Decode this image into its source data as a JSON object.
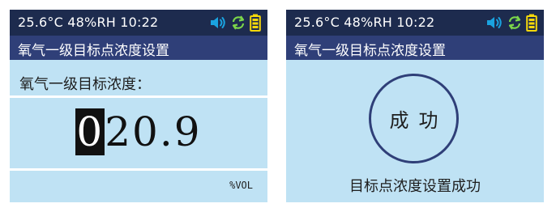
{
  "status": {
    "text": "25.6°C 48%RH 10:22",
    "icons": [
      "speaker-icon",
      "sync-icon",
      "battery-icon"
    ],
    "colors": {
      "speaker": "#1aa3e0",
      "sync": "#7bd64a",
      "battery": "#f5d80a"
    }
  },
  "left_screen": {
    "title": "氧气一级目标点浓度设置",
    "prompt": "氧气一级目标浓度：",
    "value_cursor": "0",
    "value_rest": "20.9",
    "unit": "%VOL"
  },
  "right_screen": {
    "title": "氧气一级目标点浓度设置",
    "success_label": "成功",
    "message": "目标点浓度设置成功"
  },
  "colors": {
    "screen_bg": "#bfe2f4",
    "status_bar_bg": "#1d2b4e",
    "title_bar_bg": "#2f3f78"
  }
}
